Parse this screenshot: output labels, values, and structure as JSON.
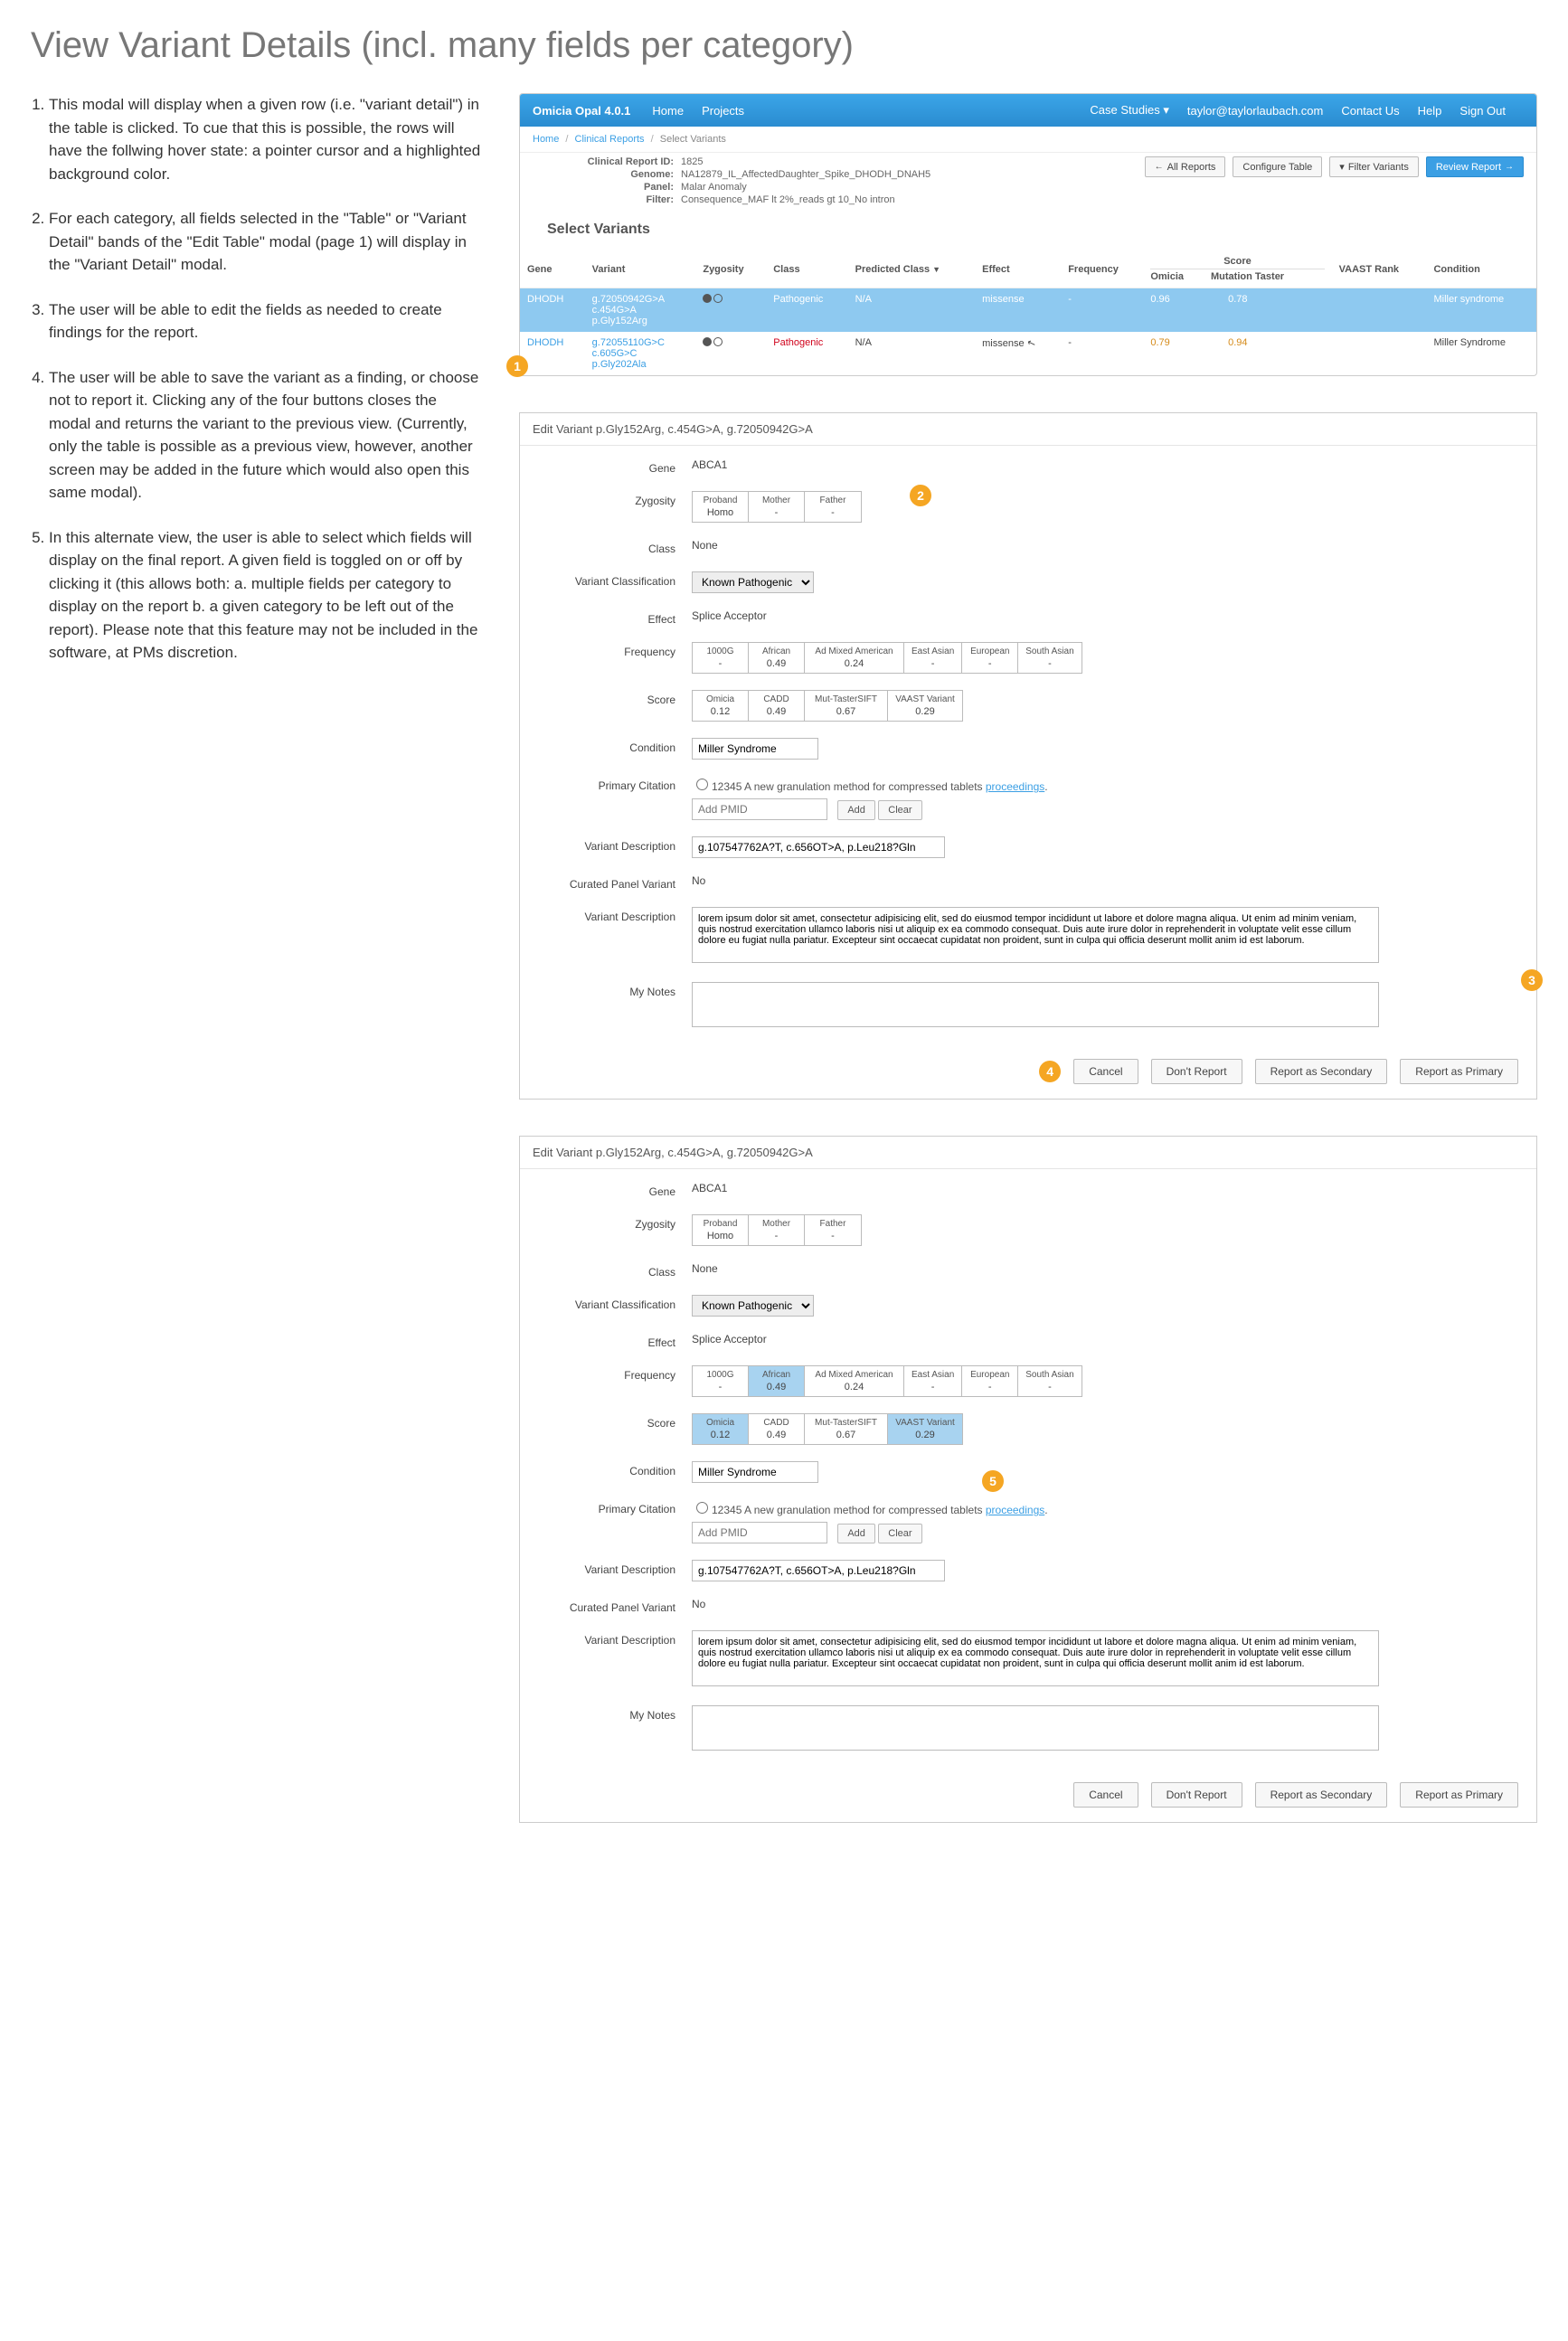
{
  "page_title": "View Variant Details (incl. many fields per category)",
  "notes": [
    "This modal will display when a given row (i.e. \"variant detail\") in the table is clicked. To cue that this is possible, the rows will have the follwing hover state:  a pointer cursor and a highlighted background color.",
    "For each category, all fields selected in the \"Table\" or \"Variant Detail\" bands of the \"Edit Table\" modal (page 1) will display in the \"Variant Detail\" modal.",
    "The user will be able to edit the fields as needed to create findings for the report.",
    "The user will be able to save the variant as a finding, or choose not to report it. Clicking any of the four buttons closes the modal and returns the variant to the previous view. (Currently, only the table is possible as a previous view, however, another screen may be added in the future which would also open this same modal).",
    "In this alternate view, the user is able to select which fields will display on the final report. A given field is toggled on or off by clicking it (this allows both: a. multiple fields per category to display on the report b. a given category to be left out of the report). Please note that this feature may not be included in the software, at PMs discretion."
  ],
  "topbar": {
    "brand": "Omicia Opal 4.0.1",
    "home": "Home",
    "projects": "Projects",
    "case_studies": "Case Studies",
    "user": "taylor@taylorlaubach.com",
    "contact": "Contact Us",
    "help": "Help",
    "signout": "Sign Out"
  },
  "crumbs": {
    "home": "Home",
    "clinical": "Clinical Reports",
    "select": "Select Variants"
  },
  "info": {
    "id_k": "Clinical Report ID:",
    "id_v": "1825",
    "genome_k": "Genome:",
    "genome_v": "NA12879_IL_AffectedDaughter_Spike_DHODH_DNAH5",
    "panel_k": "Panel:",
    "panel_v": "Malar Anomaly",
    "filter_k": "Filter:",
    "filter_v": "Consequence_MAF lt 2%_reads gt 10_No intron"
  },
  "app_buttons": {
    "all": "All Reports",
    "configure": "Configure Table",
    "filter": "Filter Variants",
    "review": "Review Report"
  },
  "section_title": "Select Variants",
  "table": {
    "headers": {
      "gene": "Gene",
      "variant": "Variant",
      "zyg": "Zygosity",
      "class": "Class",
      "pred": "Predicted  Class",
      "eff": "Effect",
      "freq": "Frequency",
      "score": "Score",
      "omicia": "Omicia",
      "mut": "Mutation Taster",
      "vaast": "VAAST Rank",
      "cond": "Condition"
    },
    "rows": [
      {
        "gene": "DHODH",
        "variant": "g.72050942G>A\nc.454G>A\np.Gly152Arg",
        "class": "Pathogenic",
        "pred": "N/A",
        "eff": "missense",
        "freq": "-",
        "omicia": "0.96",
        "mut": "0.78",
        "vaast": "",
        "cond": "Miller syndrome",
        "selected": true
      },
      {
        "gene": "DHODH",
        "variant": "g.72055110G>C\nc.605G>C\np.Gly202Ala",
        "class": "Pathogenic",
        "pred": "N/A",
        "eff": "missense",
        "freq": "-",
        "omicia": "0.79",
        "mut": "0.94",
        "vaast": "",
        "cond": "Miller Syndrome",
        "selected": false
      }
    ]
  },
  "modal_title": "Edit Variant p.Gly152Arg, c.454G>A, g.72050942G>A",
  "labels": {
    "gene": "Gene",
    "zyg": "Zygosity",
    "class": "Class",
    "vclass": "Variant Classification",
    "eff": "Effect",
    "freq": "Frequency",
    "score": "Score",
    "cond": "Condition",
    "cit": "Primary Citation",
    "vdesc": "Variant Description",
    "curated": "Curated Panel Variant",
    "notes": "My Notes"
  },
  "values": {
    "gene": "ABCA1",
    "class": "None",
    "vclass": "Known Pathogenic",
    "eff": "Splice Acceptor",
    "cond": "Miller Syndrome",
    "curated": "No",
    "vdesc1": "g.107547762A?T, c.656OT>A, p.Leu218?Gln",
    "lorem": "lorem ipsum dolor sit amet, consectetur adipisicing elit, sed do eiusmod tempor incididunt ut labore et dolore magna aliqua. Ut enim ad minim veniam, quis nostrud exercitation ullamco laboris nisi ut aliquip ex ea commodo consequat. Duis aute irure dolor in reprehenderit in voluptate velit esse cillum dolore eu fugiat nulla pariatur. Excepteur sint occaecat cupidatat non proident, sunt in culpa qui officia deserunt mollit anim id est laborum.",
    "cit_text": "12345 A new granulation method for compressed tablets ",
    "cit_link": "proceedings",
    "pmid_placeholder": "Add PMID",
    "add": "Add",
    "clear": "Clear"
  },
  "zyg_cells": [
    {
      "h": "Proband",
      "v": "Homo"
    },
    {
      "h": "Mother",
      "v": "-"
    },
    {
      "h": "Father",
      "v": "-"
    }
  ],
  "freq_cells": [
    {
      "h": "1000G",
      "v": "-"
    },
    {
      "h": "African",
      "v": "0.49"
    },
    {
      "h": "Ad Mixed American",
      "v": "0.24"
    },
    {
      "h": "East Asian",
      "v": "-"
    },
    {
      "h": "European",
      "v": "-"
    },
    {
      "h": "South Asian",
      "v": "-"
    }
  ],
  "score_cells": [
    {
      "h": "Omicia",
      "v": "0.12"
    },
    {
      "h": "CADD",
      "v": "0.49"
    },
    {
      "h": "Mut-TasterSIFT",
      "v": "0.67"
    },
    {
      "h": "VAAST Variant",
      "v": "0.29"
    }
  ],
  "footer_buttons": {
    "cancel": "Cancel",
    "dont": "Don't Report",
    "secondary": "Report as Secondary",
    "primary": "Report as Primary"
  },
  "markers": {
    "m1": "1",
    "m2": "2",
    "m3": "3",
    "m4": "4",
    "m5": "5"
  }
}
